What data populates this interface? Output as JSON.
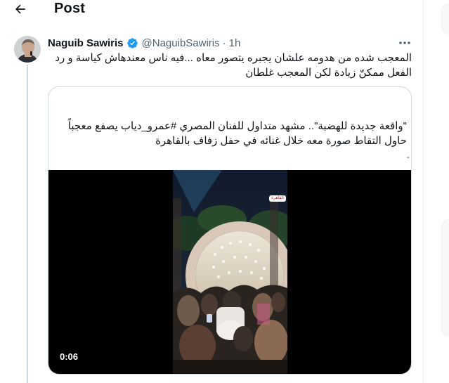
{
  "header": {
    "back_icon": "arrow-left-icon",
    "title": "Post"
  },
  "tweet": {
    "author": {
      "display_name": "Naguib Sawiris",
      "handle": "@NaguibSawiris",
      "separator": "·",
      "time": "1h",
      "verified_icon": "verified-badge-icon",
      "verified_color": "#1d9bf0"
    },
    "more_icon": "more-dots-icon",
    "text": "المعجب شده من هدومه علشان يجبره يتصور معاه ...فيه ناس معندهاش كياسة و رد الفعل ممكنّ زيادة لكن المعجب غلطان",
    "quoted": {
      "text": "\"واقعة جديدة للهضبة\".. مشهد متداول للفنان المصري #عمرو_دياب يصفع معجباً حاول التقاط صورة معه خلال غنائه في حفل زفاف بالقاهرة",
      "mark": "-",
      "video": {
        "duration": "0:06",
        "overlay_text": "القاهرة"
      }
    }
  },
  "colors": {
    "text": "#0f1419",
    "secondary": "#536471",
    "border": "#cfd9de",
    "thread_line": "#cfd9de",
    "video_bg": "#000000"
  }
}
